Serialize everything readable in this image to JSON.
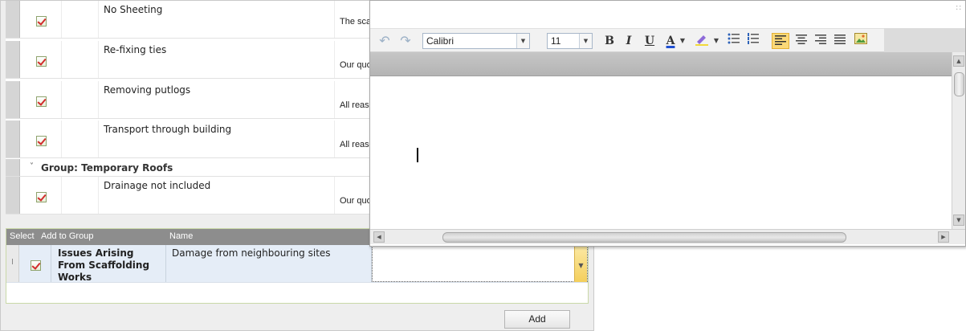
{
  "top_grid": {
    "rows": [
      {
        "name": "No Sheeting",
        "description": "The scaf"
      },
      {
        "name": "Re-fixing ties",
        "description": "Our quo"
      },
      {
        "name": "Removing putlogs",
        "description": "All reasc"
      },
      {
        "name": "Transport through building",
        "description": "All reasc"
      }
    ],
    "group": {
      "label": "Group: Temporary Roofs",
      "chevron": "˅"
    },
    "group_rows": [
      {
        "name": "Drainage not included",
        "description": "Our quo"
      }
    ]
  },
  "bottom_grid": {
    "headers": {
      "select": "Select",
      "add_to_group": "Add to Group",
      "name": "Name"
    },
    "row": {
      "add_to_group": "Issues Arising From Scaffolding Works",
      "name": "Damage from neighbouring sites",
      "gutter_marker": "I"
    }
  },
  "add_button": {
    "label": "Add"
  },
  "editor": {
    "font_family": "Calibri",
    "font_size": "11",
    "bold": "B",
    "italic": "I",
    "underline": "U",
    "font_color": "A",
    "grip": "∷",
    "icons": [
      "undo-icon",
      "redo-icon",
      "bold-icon",
      "italic-icon",
      "underline-icon",
      "font-color-icon",
      "highlight-icon",
      "bullet-list-icon",
      "numbered-list-icon",
      "align-left-icon",
      "align-center-icon",
      "align-right-icon",
      "justify-icon",
      "insert-image-icon"
    ]
  },
  "colors": {
    "accent_green": "#b7cf8a",
    "selected_row": "#e5edf7",
    "active_tool": "#fbd978",
    "check_red": "#d22c2c"
  }
}
